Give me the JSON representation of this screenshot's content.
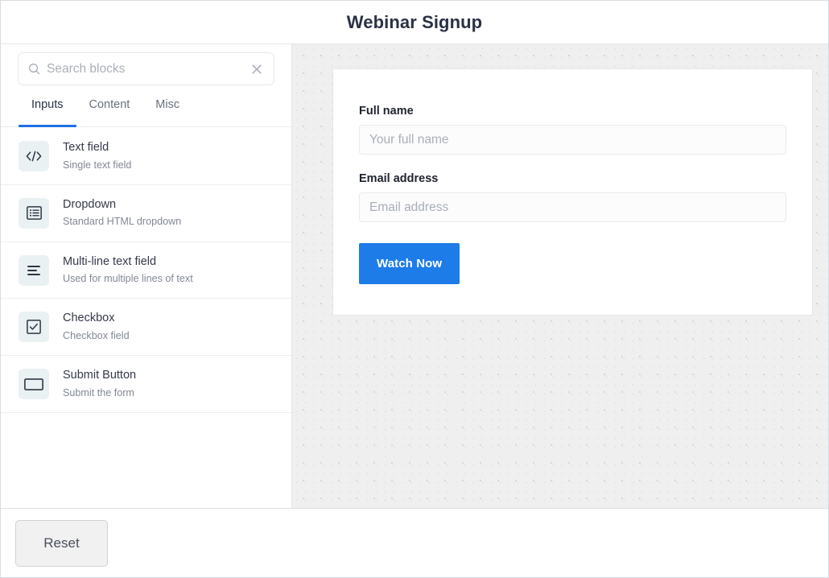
{
  "header": {
    "title": "Webinar Signup"
  },
  "sidebar": {
    "search": {
      "value": "",
      "placeholder": "Search blocks",
      "icon": "search-icon",
      "clear_icon": "close-icon"
    },
    "tabs": [
      {
        "label": "Inputs",
        "active": true
      },
      {
        "label": "Content",
        "active": false
      },
      {
        "label": "Misc",
        "active": false
      }
    ],
    "blocks": [
      {
        "title": "Text field",
        "description": "Single text field",
        "icon": "code-brackets-icon"
      },
      {
        "title": "Dropdown",
        "description": "Standard HTML dropdown",
        "icon": "list-box-icon"
      },
      {
        "title": "Multi-line text field",
        "description": "Used for multiple lines of text",
        "icon": "align-left-icon"
      },
      {
        "title": "Checkbox",
        "description": "Checkbox field",
        "icon": "checkbox-checked-icon"
      },
      {
        "title": "Submit Button",
        "description": "Submit the form",
        "icon": "button-rectangle-icon"
      }
    ]
  },
  "canvas": {
    "form": {
      "fields": [
        {
          "label": "Full name",
          "value": "",
          "placeholder": "Your full name"
        },
        {
          "label": "Email address",
          "value": "",
          "placeholder": "Email address"
        }
      ],
      "submit_label": "Watch Now"
    }
  },
  "footer": {
    "reset_label": "Reset"
  },
  "colors": {
    "accent": "#1e7ce8",
    "tab_active_underline": "#1f6fe5",
    "title": "#2a3045",
    "canvas_bg": "#efefef",
    "icon_tile_bg": "#eaf1f2"
  }
}
